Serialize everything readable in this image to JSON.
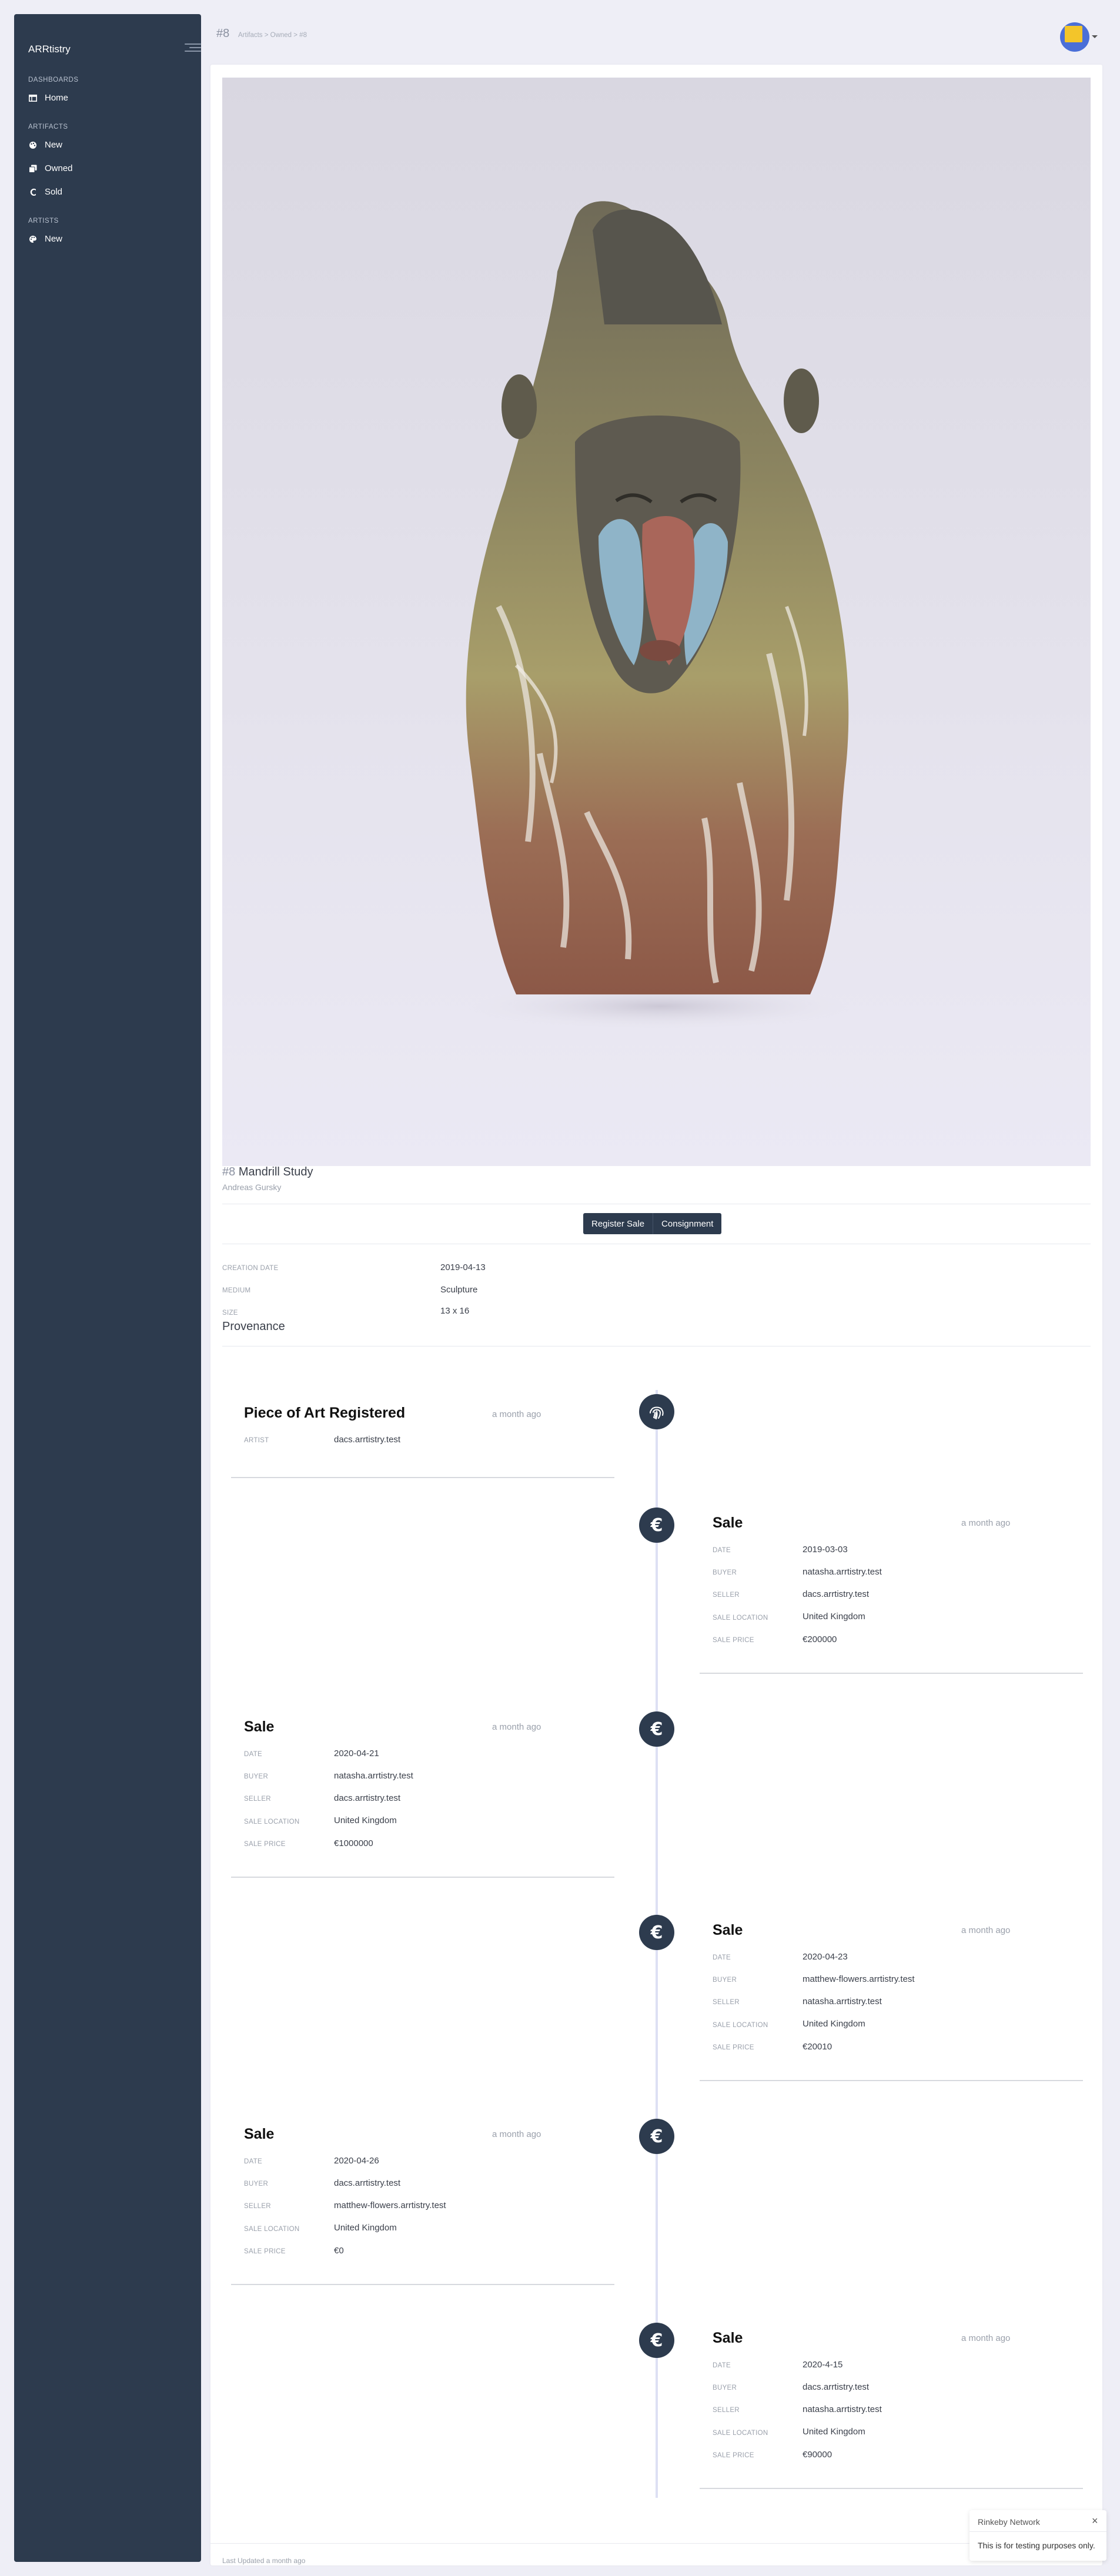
{
  "sidebar": {
    "brand": "ARRtistry",
    "sections": {
      "dashboards": "DASHBOARDS",
      "artifacts": "ARTIFACTS",
      "artists": "ARTISTS"
    },
    "items": {
      "home": "Home",
      "artifacts_new": "New",
      "owned": "Owned",
      "sold": "Sold",
      "artists_new": "New"
    }
  },
  "header": {
    "number": "#8",
    "breadcrumb": "Artifacts > Owned > #8"
  },
  "artifact": {
    "number": "#8",
    "title": "Mandrill Study",
    "artist": "Andreas Gursky",
    "image_icon": "sculpture-photo"
  },
  "actions": {
    "register_sale": "Register Sale",
    "consignment": "Consignment"
  },
  "details": {
    "creation_date_label": "CREATION DATE",
    "creation_date": "2019-04-13",
    "medium_label": "MEDIUM",
    "medium": "Sculpture",
    "size_label": "SIZE",
    "size": "13 x 16"
  },
  "provenance": {
    "heading": "Provenance",
    "labels": {
      "artist": "ARTIST",
      "date": "DATE",
      "buyer": "BUYER",
      "seller": "SELLER",
      "location": "SALE LOCATION",
      "price": "SALE PRICE"
    },
    "registered": {
      "title": "Piece of Art Registered",
      "time": "a month ago",
      "artist": "dacs.arrtistry.test",
      "icon": "fingerprint-icon"
    },
    "sales": [
      {
        "title": "Sale",
        "time": "a month ago",
        "date": "2019-03-03",
        "buyer": "natasha.arrtistry.test",
        "seller": "dacs.arrtistry.test",
        "location": "United Kingdom",
        "price": "€200000"
      },
      {
        "title": "Sale",
        "time": "a month ago",
        "date": "2020-04-21",
        "buyer": "natasha.arrtistry.test",
        "seller": "dacs.arrtistry.test",
        "location": "United Kingdom",
        "price": "€1000000"
      },
      {
        "title": "Sale",
        "time": "a month ago",
        "date": "2020-04-23",
        "buyer": "matthew-flowers.arrtistry.test",
        "seller": "natasha.arrtistry.test",
        "location": "United Kingdom",
        "price": "€20010"
      },
      {
        "title": "Sale",
        "time": "a month ago",
        "date": "2020-04-26",
        "buyer": "dacs.arrtistry.test",
        "seller": "matthew-flowers.arrtistry.test",
        "location": "United Kingdom",
        "price": "€0"
      },
      {
        "title": "Sale",
        "time": "a month ago",
        "date": "2020-4-15",
        "buyer": "dacs.arrtistry.test",
        "seller": "natasha.arrtistry.test",
        "location": "United Kingdom",
        "price": "€90000"
      }
    ],
    "sale_icon": "euro-icon",
    "euro_glyph": "€"
  },
  "footer": {
    "last_updated": "Last Updated a month ago"
  },
  "toast": {
    "title": "Rinkeby Network",
    "close": "×",
    "body": "This is for testing purposes only."
  },
  "colors": {
    "sidebar_bg": "#2d3b4e",
    "page_bg": "#eeeef6",
    "accent": "#2d3b4e",
    "timeline": "#dde0f4"
  }
}
